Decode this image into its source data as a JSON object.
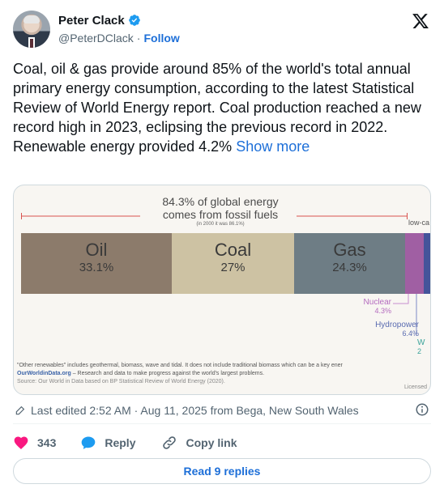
{
  "author": {
    "name": "Peter Clack",
    "handle": "@PeterDClack",
    "separator": "·",
    "follow_label": "Follow",
    "verified": true
  },
  "tweet": {
    "text": "Coal, oil & gas provide around 85% of the world's total annual primary energy consumption, according to the latest Statistical Review of World Energy report. Coal production reached a new record high in 2023, eclipsing the previous record in 2022. Renewable energy provided 4.2%",
    "show_more_label": "Show more"
  },
  "media": {
    "callout_line1": "84.3% of global energy",
    "callout_line2": "comes from fossil fuels",
    "callout_small": "(in 2000 it was 86.1%)",
    "low_carbon_label": "low-ca",
    "segments": [
      {
        "label": "Oil",
        "pct": "33.1%",
        "color": "#8c7b6b"
      },
      {
        "label": "Coal",
        "pct": "27%",
        "color": "#cdc2a3"
      },
      {
        "label": "Gas",
        "pct": "24.3%",
        "color": "#6e7d85"
      },
      {
        "label": "",
        "pct": "",
        "color": "#a05fa3"
      },
      {
        "label": "",
        "pct": "",
        "color": "#44549a"
      }
    ],
    "nuclear_label": "Nuclear",
    "nuclear_pct": "4.3%",
    "nuclear_color": "#b46bbf",
    "hydro_label": "Hydropower",
    "hydro_pct": "6.4%",
    "hydro_color": "#5a6bb0",
    "wind_label": "W",
    "wind_pct": "2",
    "wind_color": "#3aa39a",
    "footnote_line1": "\"Other renewables\" includes geothermal, biomass, wave and tidal. It does not include traditional biomass which can be a key ener",
    "footnote_owid": "OurWorldinData.org",
    "footnote_owid_rest": " – Research and data to make progress against the world's largest problems.",
    "footnote_source": "Source: Our World in Data based on BP Statistical Review of World Energy (2020).",
    "licensed": "Licensed"
  },
  "meta": {
    "edited": "Last edited 2:52 AM · Aug 11, 2025 from Bega, New South Wales"
  },
  "actions": {
    "like_count": "343",
    "reply_label": "Reply",
    "copy_link_label": "Copy link"
  },
  "read_replies_label": "Read 9 replies",
  "colors": {
    "accent": "#1d6fd8",
    "like": "#f91880",
    "secondary_text": "#536471"
  }
}
